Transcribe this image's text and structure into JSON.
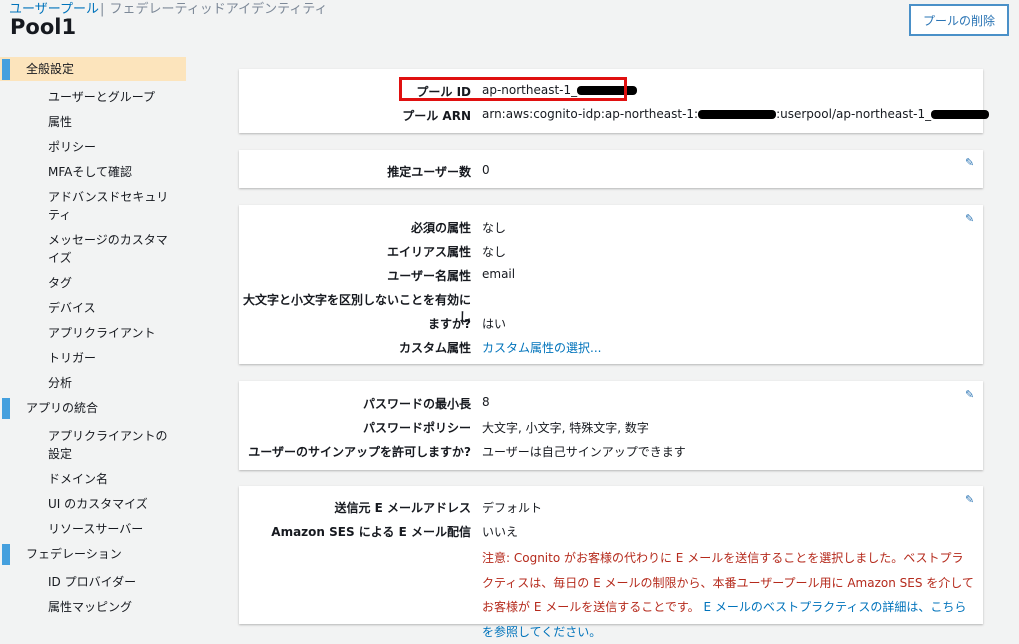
{
  "header": {
    "tab_user_pool": "ユーザープール",
    "tab_separator": "|",
    "tab_federated": "フェデレーティッドアイデンティティ",
    "title": "Pool1",
    "delete_button": "プールの削除"
  },
  "sidebar": {
    "sections": [
      {
        "label": "全般設定",
        "active": true,
        "items": [
          "ユーザーとグループ",
          "属性",
          "ポリシー",
          "MFAそして確認",
          "アドバンスドセキュリティ",
          "メッセージのカスタマイズ",
          "タグ",
          "デバイス",
          "アプリクライアント",
          "トリガー",
          "分析"
        ]
      },
      {
        "label": "アプリの統合",
        "items": [
          "アプリクライアントの設定",
          "ドメイン名",
          "UI のカスタマイズ",
          "リソースサーバー"
        ]
      },
      {
        "label": "フェデレーション",
        "items": [
          "ID プロバイダー",
          "属性マッピング"
        ]
      }
    ]
  },
  "pool_info": {
    "pool_id_label": "プール ID",
    "pool_id_value": "ap-northeast-1_",
    "pool_arn_label": "プール ARN",
    "pool_arn_prefix": "arn:aws:cognito-idp:ap-northeast-1:",
    "pool_arn_middle": ":userpool/ap-northeast-1_"
  },
  "users": {
    "estimated_users_label": "推定ユーザー数",
    "estimated_users_value": "0"
  },
  "attributes": {
    "required_label": "必須の属性",
    "required_value": "なし",
    "alias_label": "エイリアス属性",
    "alias_value": "なし",
    "username_label": "ユーザー名属性",
    "username_value": "email",
    "case_label_line1": "大文字と小文字を区別しないことを有効にし",
    "case_label_line2": "ますか?",
    "case_value": "はい",
    "custom_label": "カスタム属性",
    "custom_value": "カスタム属性の選択..."
  },
  "password": {
    "min_length_label": "パスワードの最小長",
    "min_length_value": "8",
    "policy_label": "パスワードポリシー",
    "policy_value": "大文字, 小文字, 特殊文字, 数字",
    "signup_label": "ユーザーのサインアップを許可しますか?",
    "signup_value": "ユーザーは自己サインアップできます"
  },
  "email": {
    "from_label": "送信元 E メールアドレス",
    "from_value": "デフォルト",
    "ses_label": "Amazon SES による E メール配信",
    "ses_value": "いいえ",
    "note_text": "注意: Cognito がお客様の代わりに E メールを送信することを選択しました。ベストプラクティスは、毎日の E メールの制限から、本番ユーザープール用に Amazon SES を介してお客様が E メールを送信することです。",
    "note_link": "E メールのベストプラクティスの詳細は、こちらを参照してください。"
  }
}
